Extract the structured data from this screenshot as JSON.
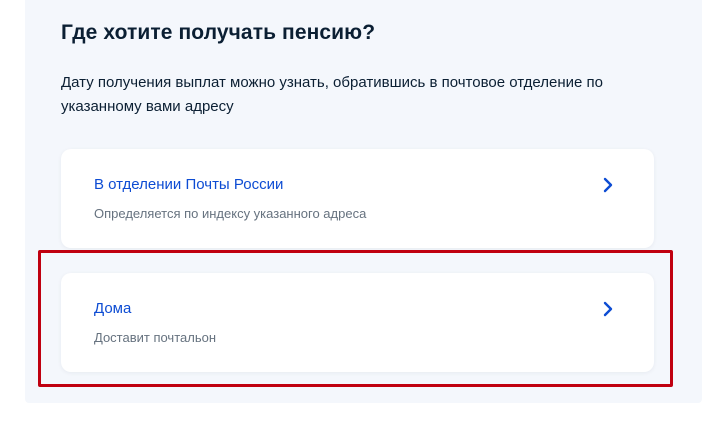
{
  "heading": {
    "title": "Где хотите получать пенсию?",
    "description": "Дату получения выплат можно узнать, обратившись в почтовое отделение по указанному вами адресу"
  },
  "options": [
    {
      "title": "В отделении Почты России",
      "subtitle": "Определяется по индексу указанного адреса",
      "icon": "chevron-right-icon"
    },
    {
      "title": "Дома",
      "subtitle": "Доставит почтальон",
      "icon": "chevron-right-icon"
    }
  ],
  "colors": {
    "link": "#0d4cd3",
    "text": "#0b1f33",
    "secondary": "#66727f",
    "panel": "#f4f7fc",
    "highlight": "#c00010"
  }
}
